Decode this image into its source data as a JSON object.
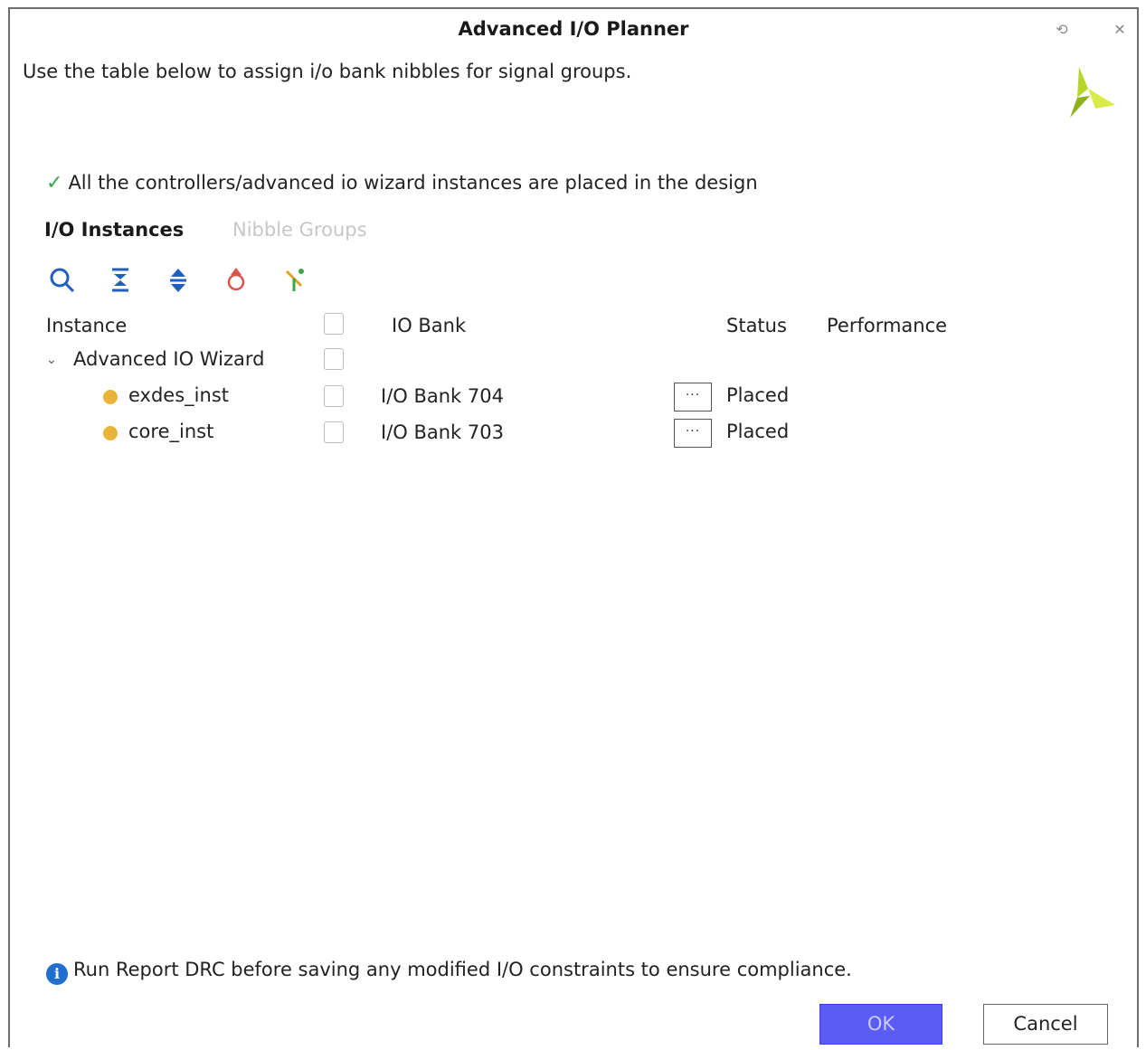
{
  "window": {
    "title": "Advanced I/O Planner",
    "minimize_glyph": "⟲",
    "close_glyph": "✕",
    "logo_icon": "xilinx-logo-icon"
  },
  "subtitle": "Use the table below to assign i/o bank nibbles for signal groups.",
  "status_message": "All the controllers/advanced io wizard instances are placed in the design",
  "tabs": [
    {
      "label": "I/O Instances",
      "active": true
    },
    {
      "label": "Nibble Groups",
      "active": false
    }
  ],
  "toolbar": [
    {
      "icon": "search-icon"
    },
    {
      "icon": "collapse-all-icon"
    },
    {
      "icon": "expand-all-icon"
    },
    {
      "icon": "auto-place-icon"
    },
    {
      "icon": "unplace-icon"
    }
  ],
  "table": {
    "headers": {
      "instance": "Instance",
      "io_bank": "IO Bank",
      "status": "Status",
      "performance": "Performance"
    },
    "group": {
      "label": "Advanced IO Wizard",
      "expanded": true
    },
    "rows": [
      {
        "instance": "exdes_inst",
        "io_bank": "I/O Bank 704",
        "more": "···",
        "status": "Placed",
        "checked": false
      },
      {
        "instance": "core_inst",
        "io_bank": "I/O Bank 703",
        "more": "···",
        "status": "Placed",
        "checked": false
      }
    ]
  },
  "info_message": "Run Report DRC before saving any modified I/O constraints to ensure compliance.",
  "buttons": {
    "ok": "OK",
    "cancel": "Cancel"
  },
  "colors": {
    "accent": "#5b5cf5",
    "check": "#3aa54a",
    "info": "#1f6fcf",
    "status_dot": "#e8b53a",
    "logo": "#a6c91a"
  }
}
